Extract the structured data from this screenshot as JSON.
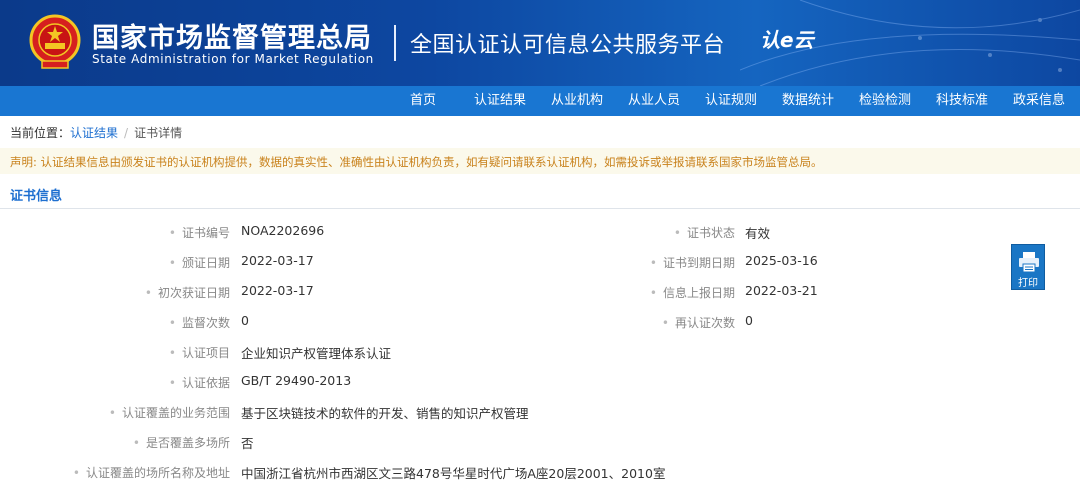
{
  "header": {
    "agency_cn": "国家市场监督管理总局",
    "agency_en": "State Administration for Market Regulation",
    "platform": "全国认证认可信息公共服务平台",
    "logo_text": "认e云",
    "emblem_icon": "national-emblem-icon",
    "brand_color": "#0d47a1"
  },
  "nav": {
    "items": [
      "首页",
      "认证结果",
      "从业机构",
      "从业人员",
      "认证规则",
      "数据统计",
      "检验检测",
      "科技标准",
      "政采信息"
    ],
    "bg_color": "#1976d2"
  },
  "breadcrumb": {
    "prefix": "当前位置：",
    "link": "认证结果",
    "separator": "/",
    "current": "证书详情"
  },
  "disclaimer": "声明: 认证结果信息由颁发证书的认证机构提供，数据的真实性、准确性由认证机构负责，如有疑问请联系认证机构，如需投诉或举报请联系国家市场监管总局。",
  "section": {
    "title": "证书信息"
  },
  "fields_left": [
    {
      "label": "证书编号",
      "value": "NOA2202696"
    },
    {
      "label": "颁证日期",
      "value": "2022-03-17"
    },
    {
      "label": "初次获证日期",
      "value": "2022-03-17"
    },
    {
      "label": "监督次数",
      "value": "0"
    },
    {
      "label": "认证项目",
      "value": "企业知识产权管理体系认证"
    },
    {
      "label": "认证依据",
      "value": "GB/T 29490-2013"
    },
    {
      "label": "认证覆盖的业务范围",
      "value": "基于区块链技术的软件的开发、销售的知识产权管理"
    },
    {
      "label": "是否覆盖多场所",
      "value": "否"
    },
    {
      "label": "认证覆盖的场所名称及地址",
      "value": "中国浙江省杭州市西湖区文三路478号华星时代广场A座20层2001、2010室"
    }
  ],
  "fields_right": [
    {
      "label": "证书状态",
      "value": "有效"
    },
    {
      "label": "证书到期日期",
      "value": "2025-03-16"
    },
    {
      "label": "信息上报日期",
      "value": "2022-03-21"
    },
    {
      "label": "再认证次数",
      "value": "0"
    }
  ],
  "print": {
    "label": "打印",
    "icon": "printer-icon"
  }
}
